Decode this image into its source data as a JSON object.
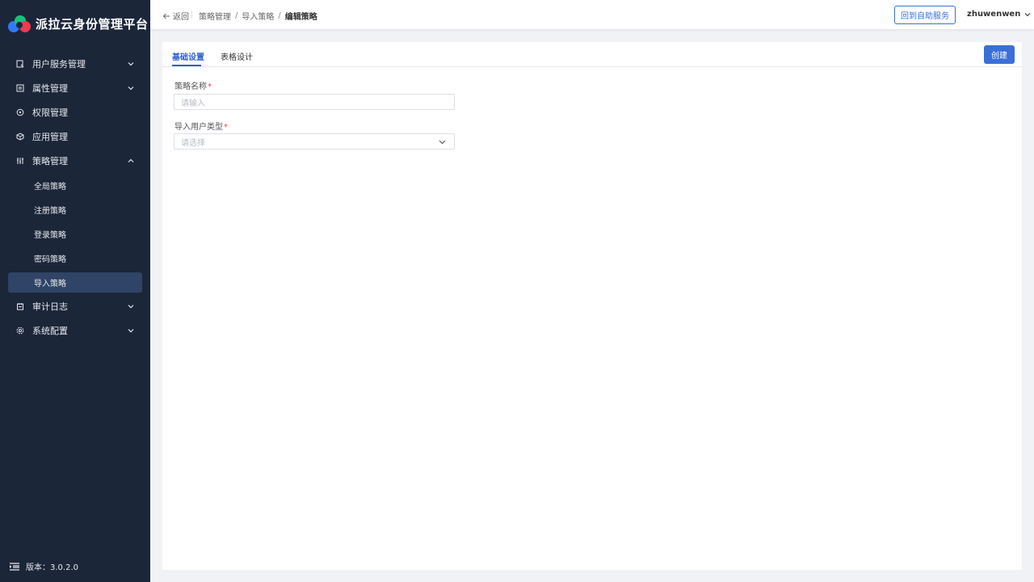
{
  "brand": {
    "title": "派拉云身份管理平台"
  },
  "sidebar": {
    "items": [
      {
        "label": "用户服务管理",
        "icon": "user-service-icon",
        "arrow": "down"
      },
      {
        "label": "属性管理",
        "icon": "attribute-icon",
        "arrow": "down"
      },
      {
        "label": "权限管理",
        "icon": "permission-icon",
        "arrow": "none"
      },
      {
        "label": "应用管理",
        "icon": "application-icon",
        "arrow": "none"
      },
      {
        "label": "策略管理",
        "icon": "policy-icon",
        "arrow": "up"
      }
    ],
    "sub_items": [
      {
        "label": "全局策略"
      },
      {
        "label": "注册策略"
      },
      {
        "label": "登录策略"
      },
      {
        "label": "密码策略"
      },
      {
        "label": "导入策略",
        "active": true
      }
    ],
    "items_after": [
      {
        "label": "审计日志",
        "icon": "audit-log-icon",
        "arrow": "down"
      },
      {
        "label": "系统配置",
        "icon": "system-config-icon",
        "arrow": "down"
      }
    ],
    "version": "版本：3.0.2.0"
  },
  "header": {
    "back_label": "返回",
    "breadcrumb": [
      "策略管理",
      "导入策略",
      "编辑策略"
    ],
    "breadcrumb_sep": "/",
    "self_service_label": "回到自助服务",
    "username": "zhuwenwen"
  },
  "tabs": [
    "基础设置",
    "表格设计"
  ],
  "create_label": "创建",
  "form": {
    "name_label": "策略名称",
    "name_placeholder": "请输入",
    "type_label": "导入用户类型",
    "type_placeholder": "请选择",
    "required_mark": "*"
  },
  "colors": {
    "sidebar_bg": "#1c2639",
    "active_bg": "#2f4466",
    "accent": "#3a6fd8",
    "required": "#e54545"
  }
}
